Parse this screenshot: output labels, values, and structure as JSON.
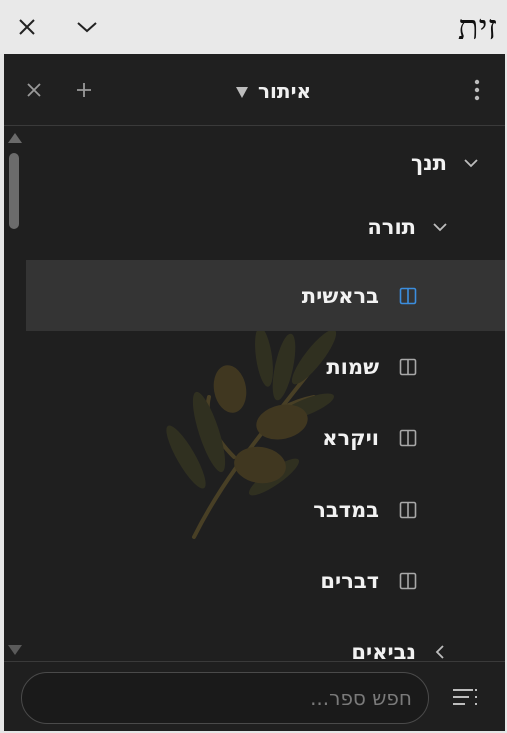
{
  "window": {
    "title": "זית",
    "close_icon": "close-icon",
    "collapse_icon": "chevron-down-icon"
  },
  "panel_header": {
    "selector_label": "איתור",
    "icons": [
      "close-icon",
      "plus-icon",
      "more-vertical-icon",
      "caret-down-icon"
    ]
  },
  "tree": {
    "accent_color": "#3b8ede",
    "root": {
      "label": "תנך",
      "expanded": true
    },
    "section": {
      "label": "תורה",
      "expanded": true
    },
    "books": [
      {
        "label": "בראשית",
        "selected": true
      },
      {
        "label": "שמות",
        "selected": false
      },
      {
        "label": "ויקרא",
        "selected": false
      },
      {
        "label": "במדבר",
        "selected": false
      },
      {
        "label": "דברים",
        "selected": false
      }
    ],
    "collapsed_section": {
      "label": "נביאים",
      "expanded": false
    }
  },
  "footer": {
    "search_placeholder": "חפש ספר...",
    "search_value": "",
    "filter_icon": "filter-list-icon"
  }
}
